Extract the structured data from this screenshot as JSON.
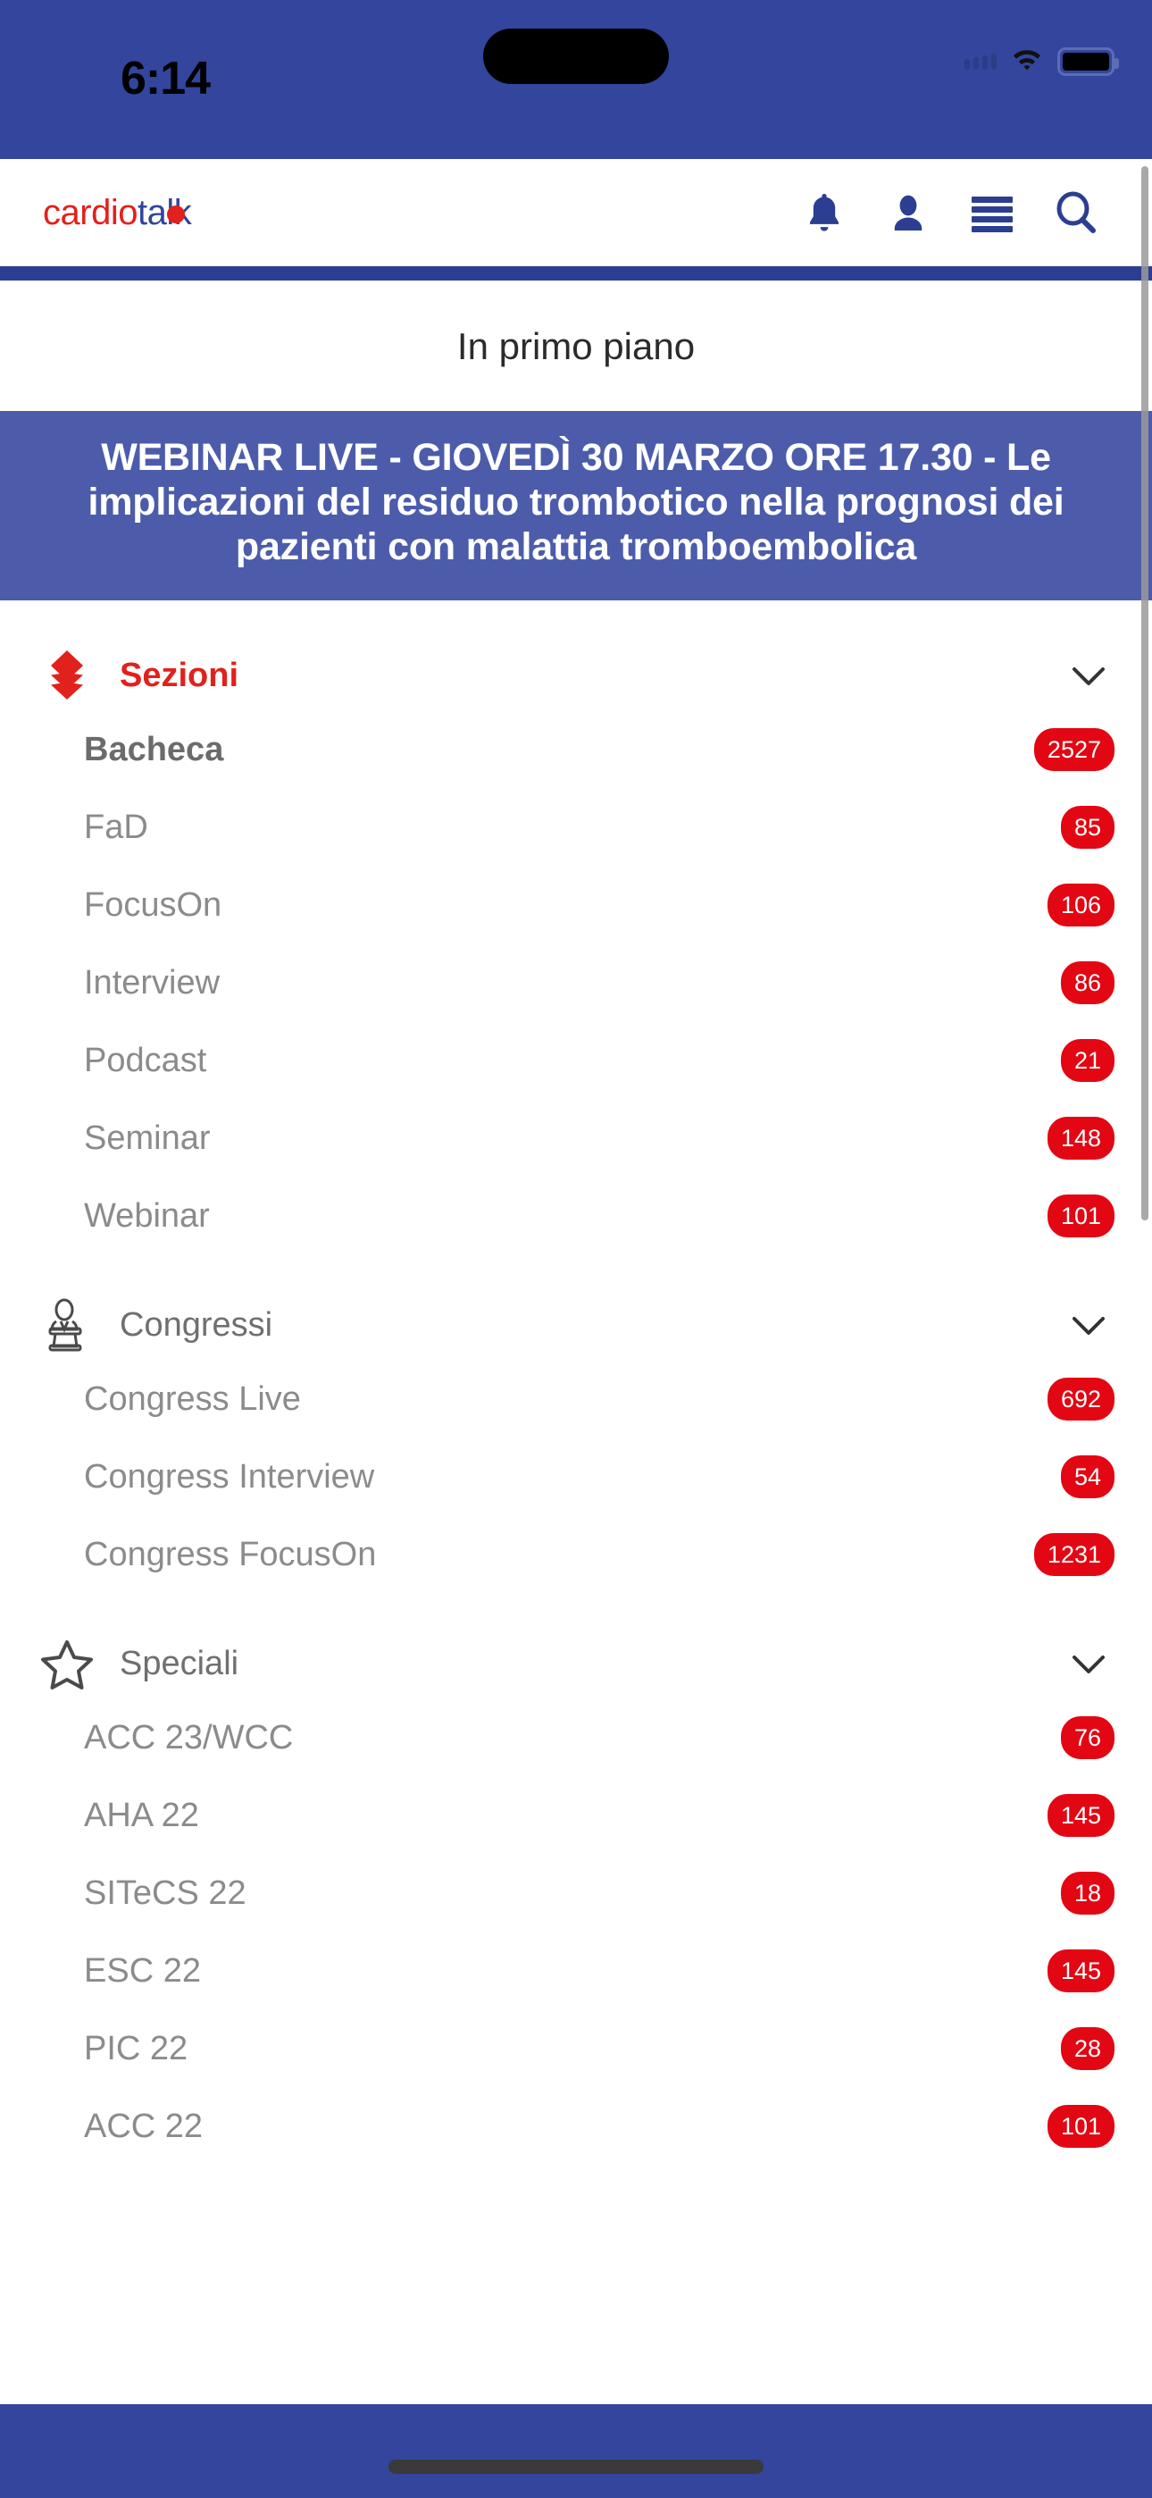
{
  "status_bar": {
    "time": "6:14",
    "icons": [
      "cellular-signal-icon",
      "wifi-icon",
      "battery-icon"
    ]
  },
  "header": {
    "logo_primary": "cardio",
    "logo_secondary": "talk",
    "nav": [
      {
        "name": "notifications-bell",
        "icon": "bell-icon"
      },
      {
        "name": "user-account",
        "icon": "person-icon"
      },
      {
        "name": "main-menu",
        "icon": "hamburger-icon"
      },
      {
        "name": "search",
        "icon": "search-icon"
      }
    ]
  },
  "featured": {
    "title": "In primo piano",
    "banner_text": "WEBINAR LIVE - GIOVEDÌ 30 MARZO ORE 17.30 - Le implicazioni del residuo trombotico nella prognosi dei pazienti con malattia tromboembolica"
  },
  "colors": {
    "brand_blue": "#33459c",
    "brand_red": "#e2211c",
    "badge_red": "#e30613",
    "banner_blue": "#4c5cab",
    "rule_blue": "#2b3e91"
  },
  "sections": [
    {
      "label": "Sezioni",
      "icon": "layers-icon",
      "style": "red",
      "chevron": "chevron-down-icon",
      "items": [
        {
          "label": "Bacheca",
          "badge": "2527",
          "emphasis": true
        },
        {
          "label": "FaD",
          "badge": "85",
          "emphasis": false
        },
        {
          "label": "FocusOn",
          "badge": "106",
          "emphasis": false
        },
        {
          "label": "Interview",
          "badge": "86",
          "emphasis": false
        },
        {
          "label": "Podcast",
          "badge": "21",
          "emphasis": false
        },
        {
          "label": "Seminar",
          "badge": "148",
          "emphasis": false
        },
        {
          "label": "Webinar",
          "badge": "101",
          "emphasis": false
        }
      ]
    },
    {
      "label": "Congressi",
      "icon": "podium-speaker-icon",
      "style": "grey",
      "chevron": "chevron-down-icon",
      "items": [
        {
          "label": "Congress Live",
          "badge": "692",
          "emphasis": false
        },
        {
          "label": "Congress Interview",
          "badge": "54",
          "emphasis": false
        },
        {
          "label": "Congress FocusOn",
          "badge": "1231",
          "emphasis": false
        }
      ]
    },
    {
      "label": "Speciali",
      "icon": "star-icon",
      "style": "grey",
      "chevron": "chevron-down-icon",
      "items": [
        {
          "label": "ACC 23/WCC",
          "badge": "76",
          "emphasis": false
        },
        {
          "label": "AHA 22",
          "badge": "145",
          "emphasis": false
        },
        {
          "label": "SITeCS 22",
          "badge": "18",
          "emphasis": false
        },
        {
          "label": "ESC 22",
          "badge": "145",
          "emphasis": false
        },
        {
          "label": "PIC 22",
          "badge": "28",
          "emphasis": false
        },
        {
          "label": "ACC 22",
          "badge": "101",
          "emphasis": false
        }
      ]
    }
  ]
}
